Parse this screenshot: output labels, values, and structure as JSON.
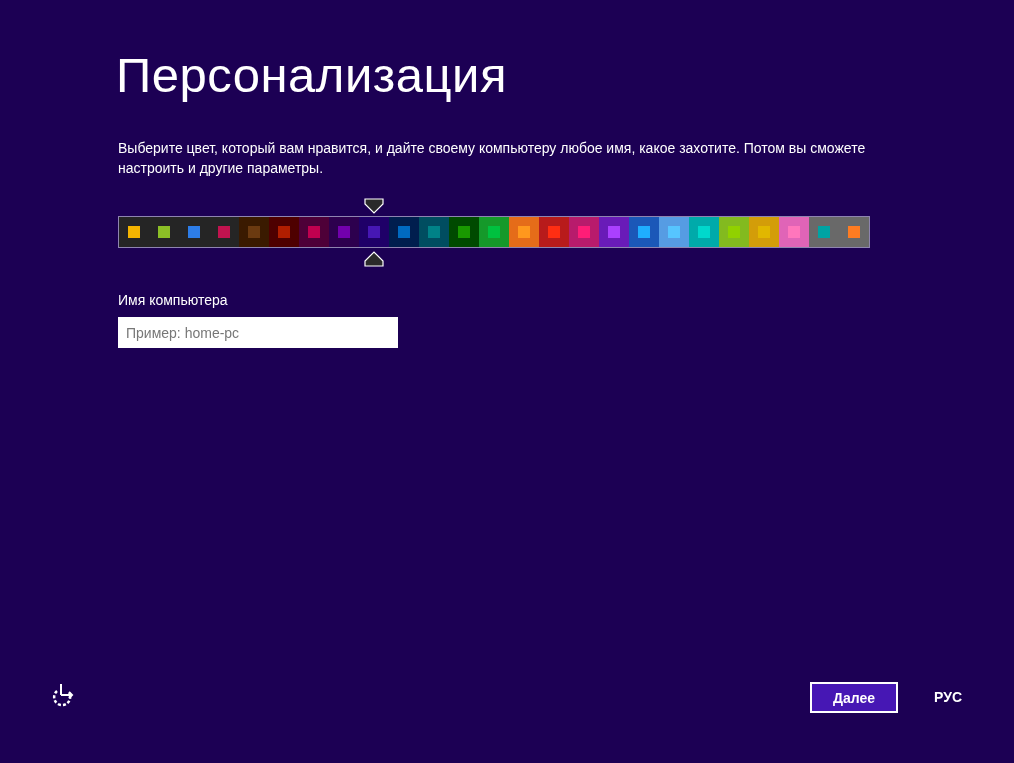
{
  "title": "Персонализация",
  "description": "Выберите цвет, который вам нравится, и дайте своему компьютеру любое имя, какое захотите. Потом вы сможете настроить и другие параметры.",
  "swatches": [
    {
      "color": "#252525",
      "square": {
        "color": "#f4b400"
      },
      "selected": false
    },
    {
      "color": "#252525",
      "square": {
        "color": "#8cbf26"
      },
      "selected": false
    },
    {
      "color": "#252525",
      "square": {
        "color": "#2d7de8"
      },
      "selected": false
    },
    {
      "color": "#252525",
      "square": {
        "color": "#c1134f"
      },
      "selected": false
    },
    {
      "color": "#3a1a00",
      "square": {
        "color": "#6b3a10"
      },
      "selected": false
    },
    {
      "color": "#4e0000",
      "square": {
        "color": "#b01e00"
      },
      "selected": false
    },
    {
      "color": "#4e0038",
      "square": {
        "color": "#c1004f"
      },
      "selected": false
    },
    {
      "color": "#2d004e",
      "square": {
        "color": "#7200ac"
      },
      "selected": false
    },
    {
      "color": "#1f0068",
      "square": {
        "color": "#4617b4"
      },
      "selected": true
    },
    {
      "color": "#001e4e",
      "square": {
        "color": "#006ac1"
      },
      "selected": false
    },
    {
      "color": "#004d60",
      "square": {
        "color": "#008287"
      },
      "selected": false
    },
    {
      "color": "#004a00",
      "square": {
        "color": "#199900"
      },
      "selected": false
    },
    {
      "color": "#15992a",
      "square": {
        "color": "#00c13f"
      },
      "selected": false
    },
    {
      "color": "#e56c19",
      "square": {
        "color": "#ff981d"
      },
      "selected": false
    },
    {
      "color": "#b81b1b",
      "square": {
        "color": "#ff2e12"
      },
      "selected": false
    },
    {
      "color": "#b81b6c",
      "square": {
        "color": "#ff1d77"
      },
      "selected": false
    },
    {
      "color": "#691bb8",
      "square": {
        "color": "#aa40ff"
      },
      "selected": false
    },
    {
      "color": "#1b58b8",
      "square": {
        "color": "#1faeff"
      },
      "selected": false
    },
    {
      "color": "#569ce3",
      "square": {
        "color": "#56c5ff"
      },
      "selected": false
    },
    {
      "color": "#00aaaa",
      "square": {
        "color": "#00d8cc"
      },
      "selected": false
    },
    {
      "color": "#83ba1f",
      "square": {
        "color": "#91d100"
      },
      "selected": false
    },
    {
      "color": "#d39d09",
      "square": {
        "color": "#e1b700"
      },
      "selected": false
    },
    {
      "color": "#e064b7",
      "square": {
        "color": "#ff76bc"
      },
      "selected": false
    },
    {
      "color": "#696969",
      "square": {
        "color": "#00a3a3"
      },
      "selected": false
    },
    {
      "color": "#696969",
      "square": {
        "color": "#fe7c22"
      },
      "selected": false
    }
  ],
  "computer_name": {
    "label": "Имя компьютера",
    "placeholder": "Пример: home-pc"
  },
  "next_button": "Далее",
  "language": "РУС"
}
